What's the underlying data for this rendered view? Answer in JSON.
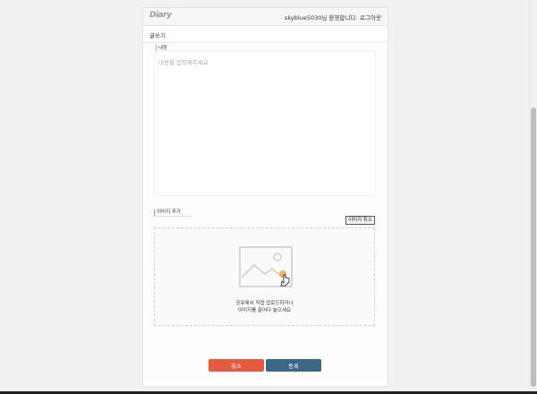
{
  "header": {
    "logo": "Diary",
    "greeting": "skyblue5030님 환영합니다.",
    "logout": "로그아웃"
  },
  "subheader": {
    "title": "글쓰기"
  },
  "content": {
    "label": "내용",
    "placeholder": "내용을 입력해주세요"
  },
  "image": {
    "label": "이미지 추가",
    "cancel_label": "이미지 취소",
    "dropzone_line1": "공유에서 직접 업로드하거나",
    "dropzone_line2": "이미지를 끌어다 놓으세요"
  },
  "actions": {
    "cancel_label": "취소",
    "submit_label": "등록"
  },
  "colors": {
    "cancel": "#e65a3f",
    "submit": "#3c6686",
    "accent": "#f0a070"
  },
  "icons": [
    "image-placeholder-icon",
    "pointer-hand-icon"
  ]
}
